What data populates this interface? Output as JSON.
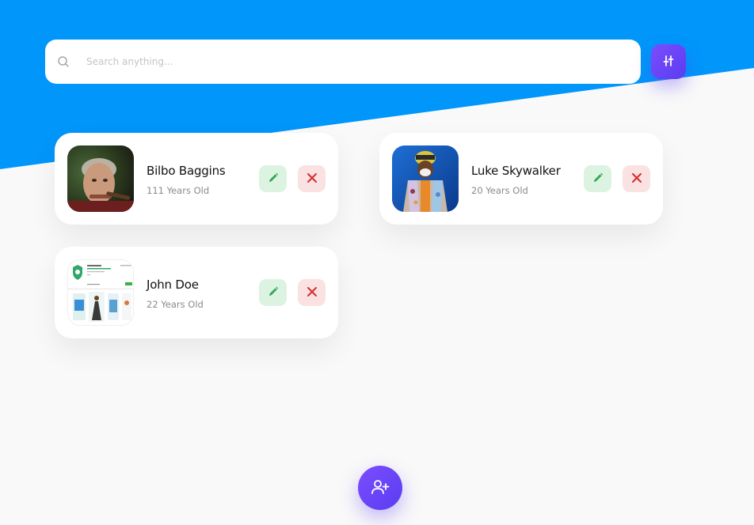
{
  "search": {
    "placeholder": "Search anything..."
  },
  "users": [
    {
      "name": "Bilbo Baggins",
      "age": "111 Years Old"
    },
    {
      "name": "Luke Skywalker",
      "age": "20 Years Old"
    },
    {
      "name": "John Doe",
      "age": "22 Years Old"
    }
  ],
  "colors": {
    "header_blue": "#0096fa",
    "accent_purple": "#6a45f7",
    "edit_bg": "#ddf3e2",
    "edit_icon": "#2fa84f",
    "delete_bg": "#fbe2e2",
    "delete_icon": "#d32f2f"
  },
  "icons": {
    "search": "search-icon",
    "filter": "sliders-icon",
    "edit": "pencil-icon",
    "delete": "close-icon",
    "add_user": "user-plus-icon"
  }
}
